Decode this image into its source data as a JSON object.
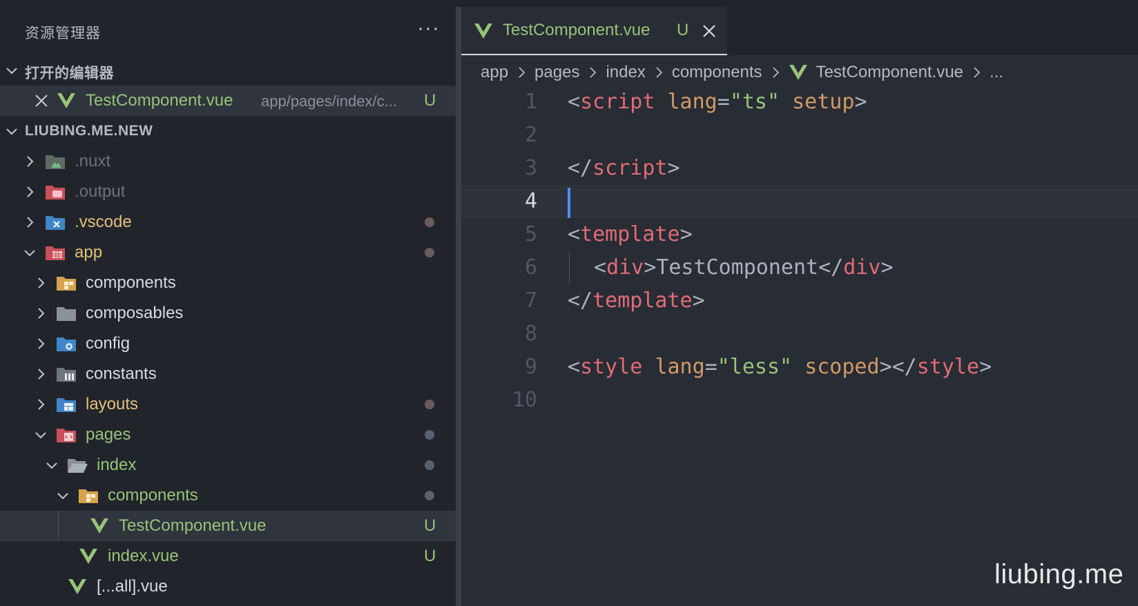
{
  "sidebar": {
    "title": "资源管理器",
    "more_label": "···",
    "open_editors_label": "打开的编辑器",
    "open_editors": [
      {
        "name": "TestComponent.vue",
        "path": "app/pages/index/c...",
        "status": "U"
      }
    ],
    "workspace_label": "LIUBING.ME.NEW",
    "tree": [
      {
        "name": ".nuxt",
        "expanded": false,
        "color": "dim"
      },
      {
        "name": ".output",
        "expanded": false,
        "color": "dim"
      },
      {
        "name": ".vscode",
        "expanded": false,
        "color": "yellow",
        "modified": true
      },
      {
        "name": "app",
        "expanded": true,
        "color": "yellow",
        "modified": true
      },
      {
        "name": "components",
        "expanded": false,
        "color": "white"
      },
      {
        "name": "composables",
        "expanded": false,
        "color": "white"
      },
      {
        "name": "config",
        "expanded": false,
        "color": "white"
      },
      {
        "name": "constants",
        "expanded": false,
        "color": "white"
      },
      {
        "name": "layouts",
        "expanded": false,
        "color": "yellow",
        "modified": true
      },
      {
        "name": "pages",
        "expanded": true,
        "color": "green",
        "modified": true
      },
      {
        "name": "index",
        "expanded": true,
        "color": "green",
        "modified": true
      },
      {
        "name": "components",
        "expanded": true,
        "color": "green",
        "modified": true
      },
      {
        "name": "TestComponent.vue",
        "color": "green",
        "status": "U"
      },
      {
        "name": "index.vue",
        "color": "green",
        "status": "U"
      },
      {
        "name": "[...all].vue",
        "color": "white"
      }
    ]
  },
  "editor": {
    "tab": {
      "label": "TestComponent.vue",
      "status": "U"
    },
    "breadcrumb": [
      "app",
      "pages",
      "index",
      "components",
      "TestComponent.vue",
      "..."
    ],
    "current_line": 4,
    "line_numbers": [
      "1",
      "2",
      "3",
      "4",
      "5",
      "6",
      "7",
      "8",
      "9",
      "10"
    ],
    "code": {
      "l1": {
        "open": "<",
        "tag": "script",
        "attr1": "lang",
        "eq": "=",
        "str": "\"ts\"",
        "attr2": "setup",
        "close": ">"
      },
      "l3": {
        "open": "</",
        "tag": "script",
        "close": ">"
      },
      "l5": {
        "open": "<",
        "tag": "template",
        "close": ">"
      },
      "l6": {
        "open1": "<",
        "tag1": "div",
        "close1": ">",
        "text": "TestComponent",
        "open2": "</",
        "tag2": "div",
        "close2": ">"
      },
      "l7": {
        "open": "</",
        "tag": "template",
        "close": ">"
      },
      "l9": {
        "open1": "<",
        "tag1": "style",
        "attr1": "lang",
        "eq": "=",
        "str": "\"less\"",
        "attr2": "scoped",
        "close1": ">",
        "open2": "</",
        "tag2": "style",
        "close2": ">"
      }
    }
  },
  "watermark": "liubing.me",
  "colors": {
    "sidebar_bg": "#21252b",
    "editor_bg": "#282c34",
    "green": "#98c379",
    "yellow": "#e5c07b",
    "tag": "#e06c75",
    "attr": "#d19a66",
    "cursor": "#528bff"
  }
}
